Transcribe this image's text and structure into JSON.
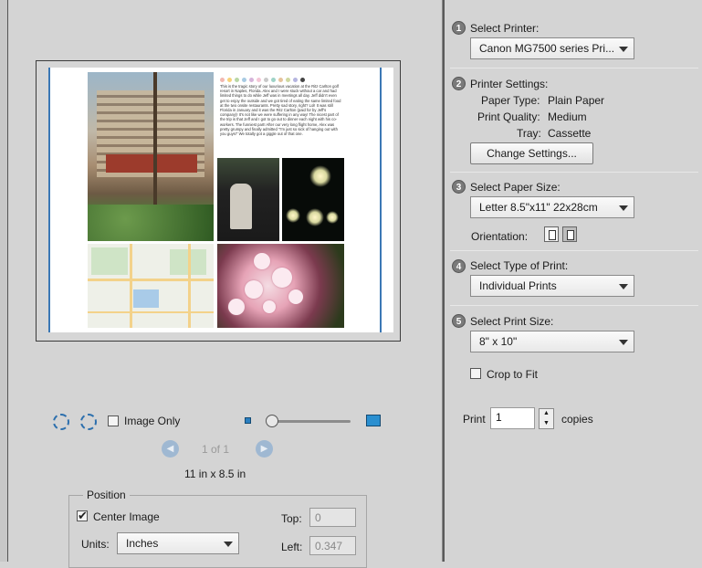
{
  "preview": {
    "journal_text": "This is the tragic story of our luxurious vacation at the Ritz Carlton golf resort in Naples, Florida. Alex and I were stuck without a car and had limited things to do while Jeff was in meetings all day. Jeff didn't even get to enjoy the outside and we got tired of eating the same limited food at the two onsite restaurants. Pretty sad story, right? Lol! It was still Florida in January and it was the Ritz Carlton (paid for by Jeff's company)! It's not like we were suffering in any way! The nicest part of the trip is that Jeff and I got to go out to dinner each night with his co-workers. The funniest part! After our very long flight home, Alex was pretty grumpy and finally admitted \"I'm just so sick of hanging out with you guys!\" We totally got a giggle out of that one.",
    "dot_colors": [
      "#f2b8b0",
      "#f6d27a",
      "#b9d7a6",
      "#a8cbe3",
      "#d6b4da",
      "#f4c6d6",
      "#c9c9c9",
      "#9fd3c7",
      "#e6c39b",
      "#cfd8a0",
      "#b5b5e0",
      "#444444"
    ]
  },
  "controls": {
    "image_only_label": "Image Only",
    "page_indicator": "1 of 1",
    "paper_dimensions": "11 in x 8.5 in",
    "prev_icon": "prev-page-icon",
    "next_icon": "next-page-icon"
  },
  "position": {
    "title": "Position",
    "center_image_label": "Center Image",
    "center_image_checked": true,
    "units_label": "Units:",
    "units_value": "Inches",
    "top_label": "Top:",
    "top_value": "0",
    "left_label": "Left:",
    "left_value": "0.347"
  },
  "steps": [
    {
      "num": "1",
      "label": "Select Printer:"
    },
    {
      "num": "2",
      "label": "Printer Settings:"
    },
    {
      "num": "3",
      "label": "Select Paper Size:"
    },
    {
      "num": "4",
      "label": "Select Type of Print:"
    },
    {
      "num": "5",
      "label": "Select Print Size:"
    }
  ],
  "printer": {
    "value": "Canon MG7500 series Pri..."
  },
  "printer_settings": {
    "paper_type_label": "Paper Type:",
    "paper_type_value": "Plain Paper",
    "print_quality_label": "Print Quality:",
    "print_quality_value": "Medium",
    "tray_label": "Tray:",
    "tray_value": "Cassette",
    "change_button": "Change Settings..."
  },
  "paper_size": {
    "value": "Letter 8.5\"x11\" 22x28cm",
    "orientation_label": "Orientation:",
    "orientation_selected": "landscape"
  },
  "print_type": {
    "value": "Individual Prints"
  },
  "print_size": {
    "value": "8\" x 10\"",
    "crop_to_fit_label": "Crop to Fit",
    "crop_to_fit_checked": false
  },
  "copies": {
    "print_label": "Print",
    "value": "1",
    "copies_label": "copies"
  }
}
